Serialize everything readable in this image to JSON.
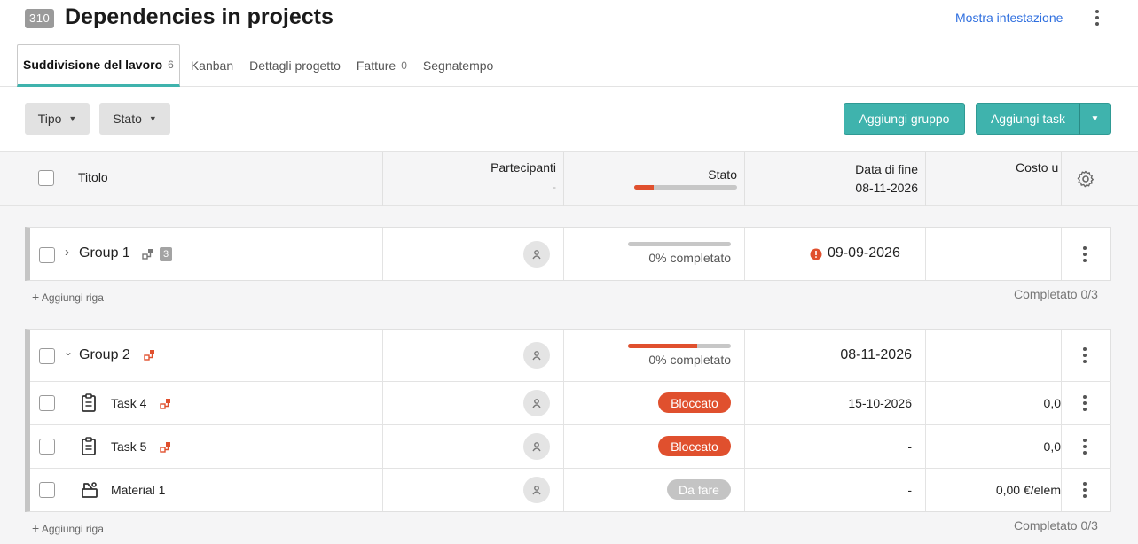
{
  "header": {
    "project_id": "310",
    "title": "Dependencies in projects",
    "show_header_link": "Mostra intestazione"
  },
  "tabs": [
    {
      "label": "Suddivisione del lavoro",
      "count": "6",
      "active": true
    },
    {
      "label": "Kanban",
      "count": ""
    },
    {
      "label": "Dettagli progetto",
      "count": ""
    },
    {
      "label": "Fatture",
      "count": "0"
    },
    {
      "label": "Segnatempo",
      "count": ""
    }
  ],
  "toolbar": {
    "filter_type": "Tipo",
    "filter_status": "Stato",
    "add_group": "Aggiungi gruppo",
    "add_task": "Aggiungi task"
  },
  "table_header": {
    "title": "Titolo",
    "participants": "Partecipanti",
    "participants_sub": "-",
    "status": "Stato",
    "status_progress": 0.19,
    "end_date": "Data di fine",
    "end_date_value": "08-11-2026",
    "cost": "Costo u"
  },
  "groups": [
    {
      "title": "Group 1",
      "child_count": "3",
      "progress_label": "0% completato",
      "progress_red": 0,
      "end_date": "09-09-2026",
      "add_row": "Aggiungi riga",
      "completed": "Completato 0/3"
    },
    {
      "title": "Group 2",
      "progress_label": "0% completato",
      "progress_red": 0.67,
      "end_date": "08-11-2026",
      "add_row": "Aggiungi riga",
      "completed": "Completato 0/3",
      "rows": [
        {
          "title": "Task 4",
          "status": "Bloccato",
          "end_date": "15-10-2026",
          "cost": "0,0"
        },
        {
          "title": "Task 5",
          "status": "Bloccato",
          "end_date": "-",
          "cost": "0,0"
        },
        {
          "title": "Material 1",
          "status": "Da fare",
          "end_date": "-",
          "cost": "0,00 €/elem"
        }
      ]
    }
  ],
  "colors": {
    "accent": "#3fb3ad",
    "blocked": "#e0502e",
    "todo": "#c4c4c4",
    "link": "#2f6fdf"
  }
}
